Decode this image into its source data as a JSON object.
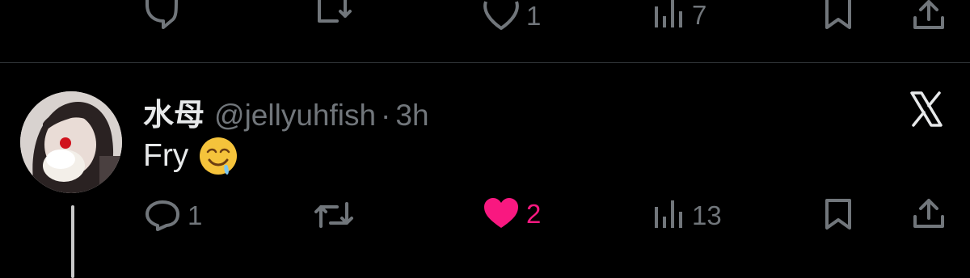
{
  "top_actions": {
    "reply_count": "",
    "retweet_count": "",
    "like_count": "1",
    "views_count": "7"
  },
  "tweet": {
    "display_name": "水母",
    "handle": "@jellyuhfish",
    "separator": "·",
    "time": "3h",
    "text": "Fry",
    "emoji": "drooling-face",
    "actions": {
      "reply_count": "1",
      "retweet_count": "",
      "like_count": "2",
      "views_count": "13",
      "liked": true
    }
  },
  "colors": {
    "background": "#000000",
    "text": "#e7e9ea",
    "muted": "#71767b",
    "like": "#f91880",
    "divider": "#2f3336"
  }
}
